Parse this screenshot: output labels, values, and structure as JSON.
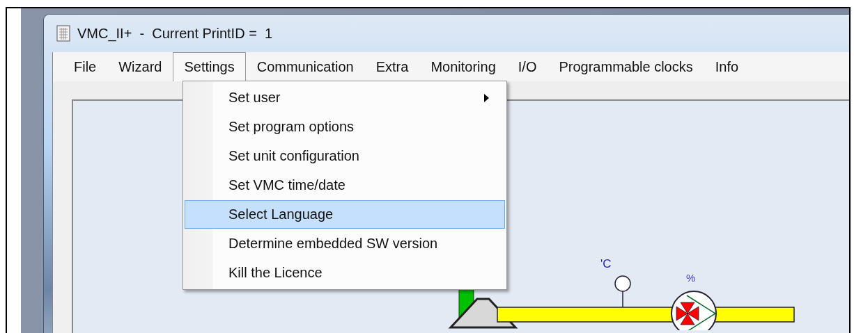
{
  "window": {
    "title": "VMC_II+  -  Current PrintID =  1"
  },
  "menu_bar": [
    {
      "label": "File",
      "selected": false
    },
    {
      "label": "Wizard",
      "selected": false
    },
    {
      "label": "Settings",
      "selected": true
    },
    {
      "label": "Communication",
      "selected": false
    },
    {
      "label": "Extra",
      "selected": false
    },
    {
      "label": "Monitoring",
      "selected": false
    },
    {
      "label": "I/O",
      "selected": false
    },
    {
      "label": "Programmable clocks",
      "selected": false
    },
    {
      "label": "Info",
      "selected": false
    }
  ],
  "dropdown": {
    "items": [
      {
        "label": "Set user",
        "submenu": true,
        "selected": false
      },
      {
        "label": "Set program options",
        "submenu": false,
        "selected": false
      },
      {
        "label": "Set unit configuration",
        "submenu": false,
        "selected": false
      },
      {
        "label": "Set VMC time/date",
        "submenu": false,
        "selected": false
      },
      {
        "label": "Select Language",
        "submenu": false,
        "selected": true
      },
      {
        "label": "Determine embedded SW version",
        "submenu": false,
        "selected": false
      },
      {
        "label": "Kill the Licence",
        "submenu": false,
        "selected": false
      }
    ]
  },
  "diagram": {
    "temperature_unit": "'C",
    "fan_unit": "%"
  }
}
